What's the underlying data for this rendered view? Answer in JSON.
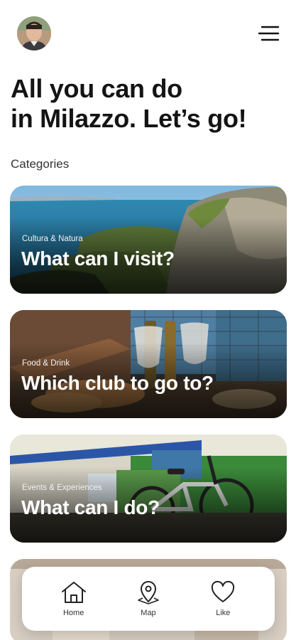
{
  "header": {
    "avatar_icon": "user-avatar",
    "menu_icon": "hamburger-menu-icon"
  },
  "headline": {
    "line1": "All you can do",
    "line2_bold": "in Milazzo.",
    "line2_rest": " Let’s go!"
  },
  "categories": {
    "label": "Categories",
    "cards": [
      {
        "kicker": "Cultura & Natura",
        "title": "What can I visit?"
      },
      {
        "kicker": "Food & Drink",
        "title": "Which club to go to?"
      },
      {
        "kicker": "Events & Experiences",
        "title": "What can I do?"
      }
    ]
  },
  "tabbar": {
    "tabs": [
      {
        "icon": "home-icon",
        "label": "Home"
      },
      {
        "icon": "map-pin-icon",
        "label": "Map"
      },
      {
        "icon": "heart-icon",
        "label": "Like"
      }
    ]
  }
}
